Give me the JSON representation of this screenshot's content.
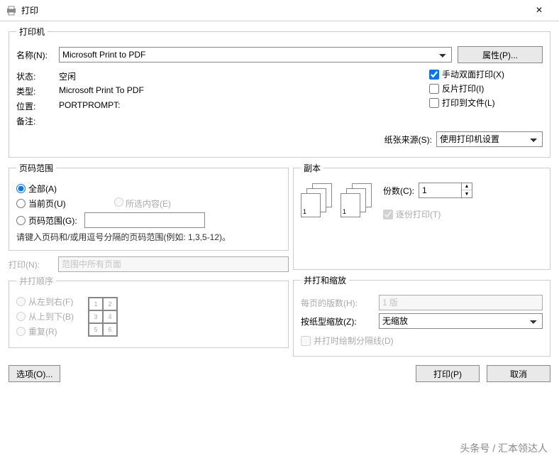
{
  "titlebar": {
    "title": "打印",
    "close": "×"
  },
  "printer": {
    "legend": "打印机",
    "name_label": "名称(N):",
    "name_value": "Microsoft Print to PDF",
    "properties_btn": "属性(P)...",
    "status_label": "状态:",
    "status_value": "空闲",
    "type_label": "类型:",
    "type_value": "Microsoft Print To PDF",
    "where_label": "位置:",
    "where_value": "PORTPROMPT:",
    "comment_label": "备注:",
    "comment_value": "",
    "duplex": "手动双面打印(X)",
    "reverse": "反片打印(I)",
    "tofile": "打印到文件(L)",
    "source_label": "纸张来源(S):",
    "source_value": "使用打印机设置"
  },
  "range": {
    "legend": "页码范围",
    "all": "全部(A)",
    "current": "当前页(U)",
    "selection": "所选内容(E)",
    "pages": "页码范围(G):",
    "pages_value": "",
    "hint": "请键入页码和/或用逗号分隔的页码范围(例如: 1,3,5-12)。"
  },
  "copies": {
    "legend": "副本",
    "count_label": "份数(C):",
    "count_value": "1",
    "collate": "逐份打印(T)"
  },
  "printwhat": {
    "label": "打印(N):",
    "value": "范围中所有页面"
  },
  "order": {
    "legend": "并打顺序",
    "lr": "从左到右(F)",
    "tb": "从上到下(B)",
    "repeat": "重复(R)"
  },
  "zoom": {
    "legend": "并打和缩放",
    "pages_per_label": "每页的版数(H):",
    "pages_per_value": "1 版",
    "scale_label": "按纸型缩放(Z):",
    "scale_value": "无缩放",
    "draw_lines": "并打时绘制分隔线(D)"
  },
  "buttons": {
    "options": "选项(O)...",
    "print": "打印(P)",
    "cancel": "取消"
  },
  "watermark": "头条号 / 汇本领达人"
}
